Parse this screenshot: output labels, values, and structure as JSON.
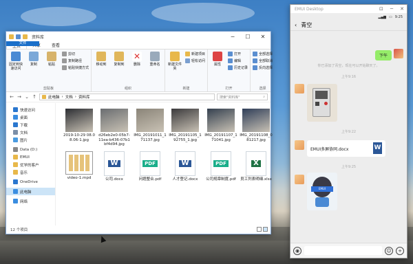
{
  "explorer": {
    "title": "资料库",
    "tabs": [
      "文件",
      "主页",
      "共享",
      "查看"
    ],
    "ribbon": {
      "clipboard": {
        "pin": "固定到快速访问",
        "copy": "复制",
        "paste": "粘贴",
        "cut": "剪切",
        "copy_path": "复制路径",
        "paste_shortcut": "粘贴快捷方式",
        "label": "剪贴板"
      },
      "organize": {
        "move_to": "移动到",
        "copy_to": "复制到",
        "delete": "删除",
        "rename": "重命名",
        "label": "组织"
      },
      "new": {
        "new_folder": "新建文件夹",
        "new_item": "新建项目",
        "easy_access": "轻松访问",
        "label": "新建"
      },
      "open": {
        "properties": "属性",
        "open": "打开",
        "edit": "编辑",
        "history": "历史记录",
        "label": "打开"
      },
      "select": {
        "select_all": "全部选择",
        "select_none": "全部取消",
        "invert": "反向选择",
        "label": "选择"
      }
    },
    "address": {
      "path": [
        "此电脑",
        "文档",
        "资料库"
      ],
      "search_placeholder": "搜索\"资料库\""
    },
    "nav": [
      {
        "label": "快速访问",
        "icon": "star-icon",
        "color": "#2a77cf"
      },
      {
        "label": "桌面",
        "icon": "desktop-icon",
        "color": "#3a8de0"
      },
      {
        "label": "下载",
        "icon": "download-icon",
        "color": "#2a77cf"
      },
      {
        "label": "文档",
        "icon": "document-icon",
        "color": "#7b8fa8"
      },
      {
        "label": "图片",
        "icon": "picture-icon",
        "color": "#4a9be0"
      },
      {
        "label": "Data (D:)",
        "icon": "drive-icon",
        "color": "#888"
      },
      {
        "label": "EMUI",
        "icon": "folder-icon",
        "color": "#e8b84a"
      },
      {
        "label": "优学的客户",
        "icon": "folder-icon",
        "color": "#e8b84a"
      },
      {
        "label": "音乐",
        "icon": "music-icon",
        "color": "#e8b84a"
      },
      {
        "label": "OneDrive",
        "icon": "cloud-icon",
        "color": "#2a77cf"
      },
      {
        "label": "此电脑",
        "icon": "computer-icon",
        "color": "#3a8de0",
        "selected": true
      },
      {
        "label": "网络",
        "icon": "network-icon",
        "color": "#3a8de0"
      }
    ],
    "files": [
      {
        "name": "2019-10-29 08.08.06-1.jpg",
        "type": "image",
        "shade": "#2c2e33"
      },
      {
        "name": "d26eb2e0-05b7-11ea-b436-07b1bf4d94.jpg",
        "type": "image",
        "shade": "#6a6d70"
      },
      {
        "name": "IMG_20191011_171137.jpg",
        "type": "image",
        "shade": "#8a8478"
      },
      {
        "name": "IMG_20191105_192755_1.jpg",
        "type": "image",
        "shade": "#3b3a3c"
      },
      {
        "name": "IMG_20191107_171041.jpg",
        "type": "image",
        "shade": "#34404f"
      },
      {
        "name": "IMG_20191108_081217.jpg",
        "type": "image",
        "shade": "#2f3e58"
      },
      {
        "name": "video-1.mpd",
        "type": "video"
      },
      {
        "name": "公司.docx",
        "type": "word"
      },
      {
        "name": "问题整合.pdf",
        "type": "pdf"
      },
      {
        "name": "人才登记.docx",
        "type": "word"
      },
      {
        "name": "公司规章制度.pdf",
        "type": "pdf"
      },
      {
        "name": "员工列表明细.xlsx",
        "type": "excel"
      }
    ],
    "status": "12 个项目"
  },
  "phone": {
    "window_title": "EMUI Desktop",
    "status_time": "9:25",
    "chat_title": "青空",
    "timestamps": [
      "上午9:16",
      "上午9:22",
      "上午9:25"
    ],
    "sent_text": "下午",
    "system_notice": "你已添加了青空，现在可以开始聊天了。",
    "file_message": "EMUI多屏协同.docx",
    "colors": {
      "sent_bubble": "#95ec69",
      "word_blue": "#2b5797",
      "pdf_green": "#1aae8a",
      "excel_green": "#1f7244"
    }
  }
}
